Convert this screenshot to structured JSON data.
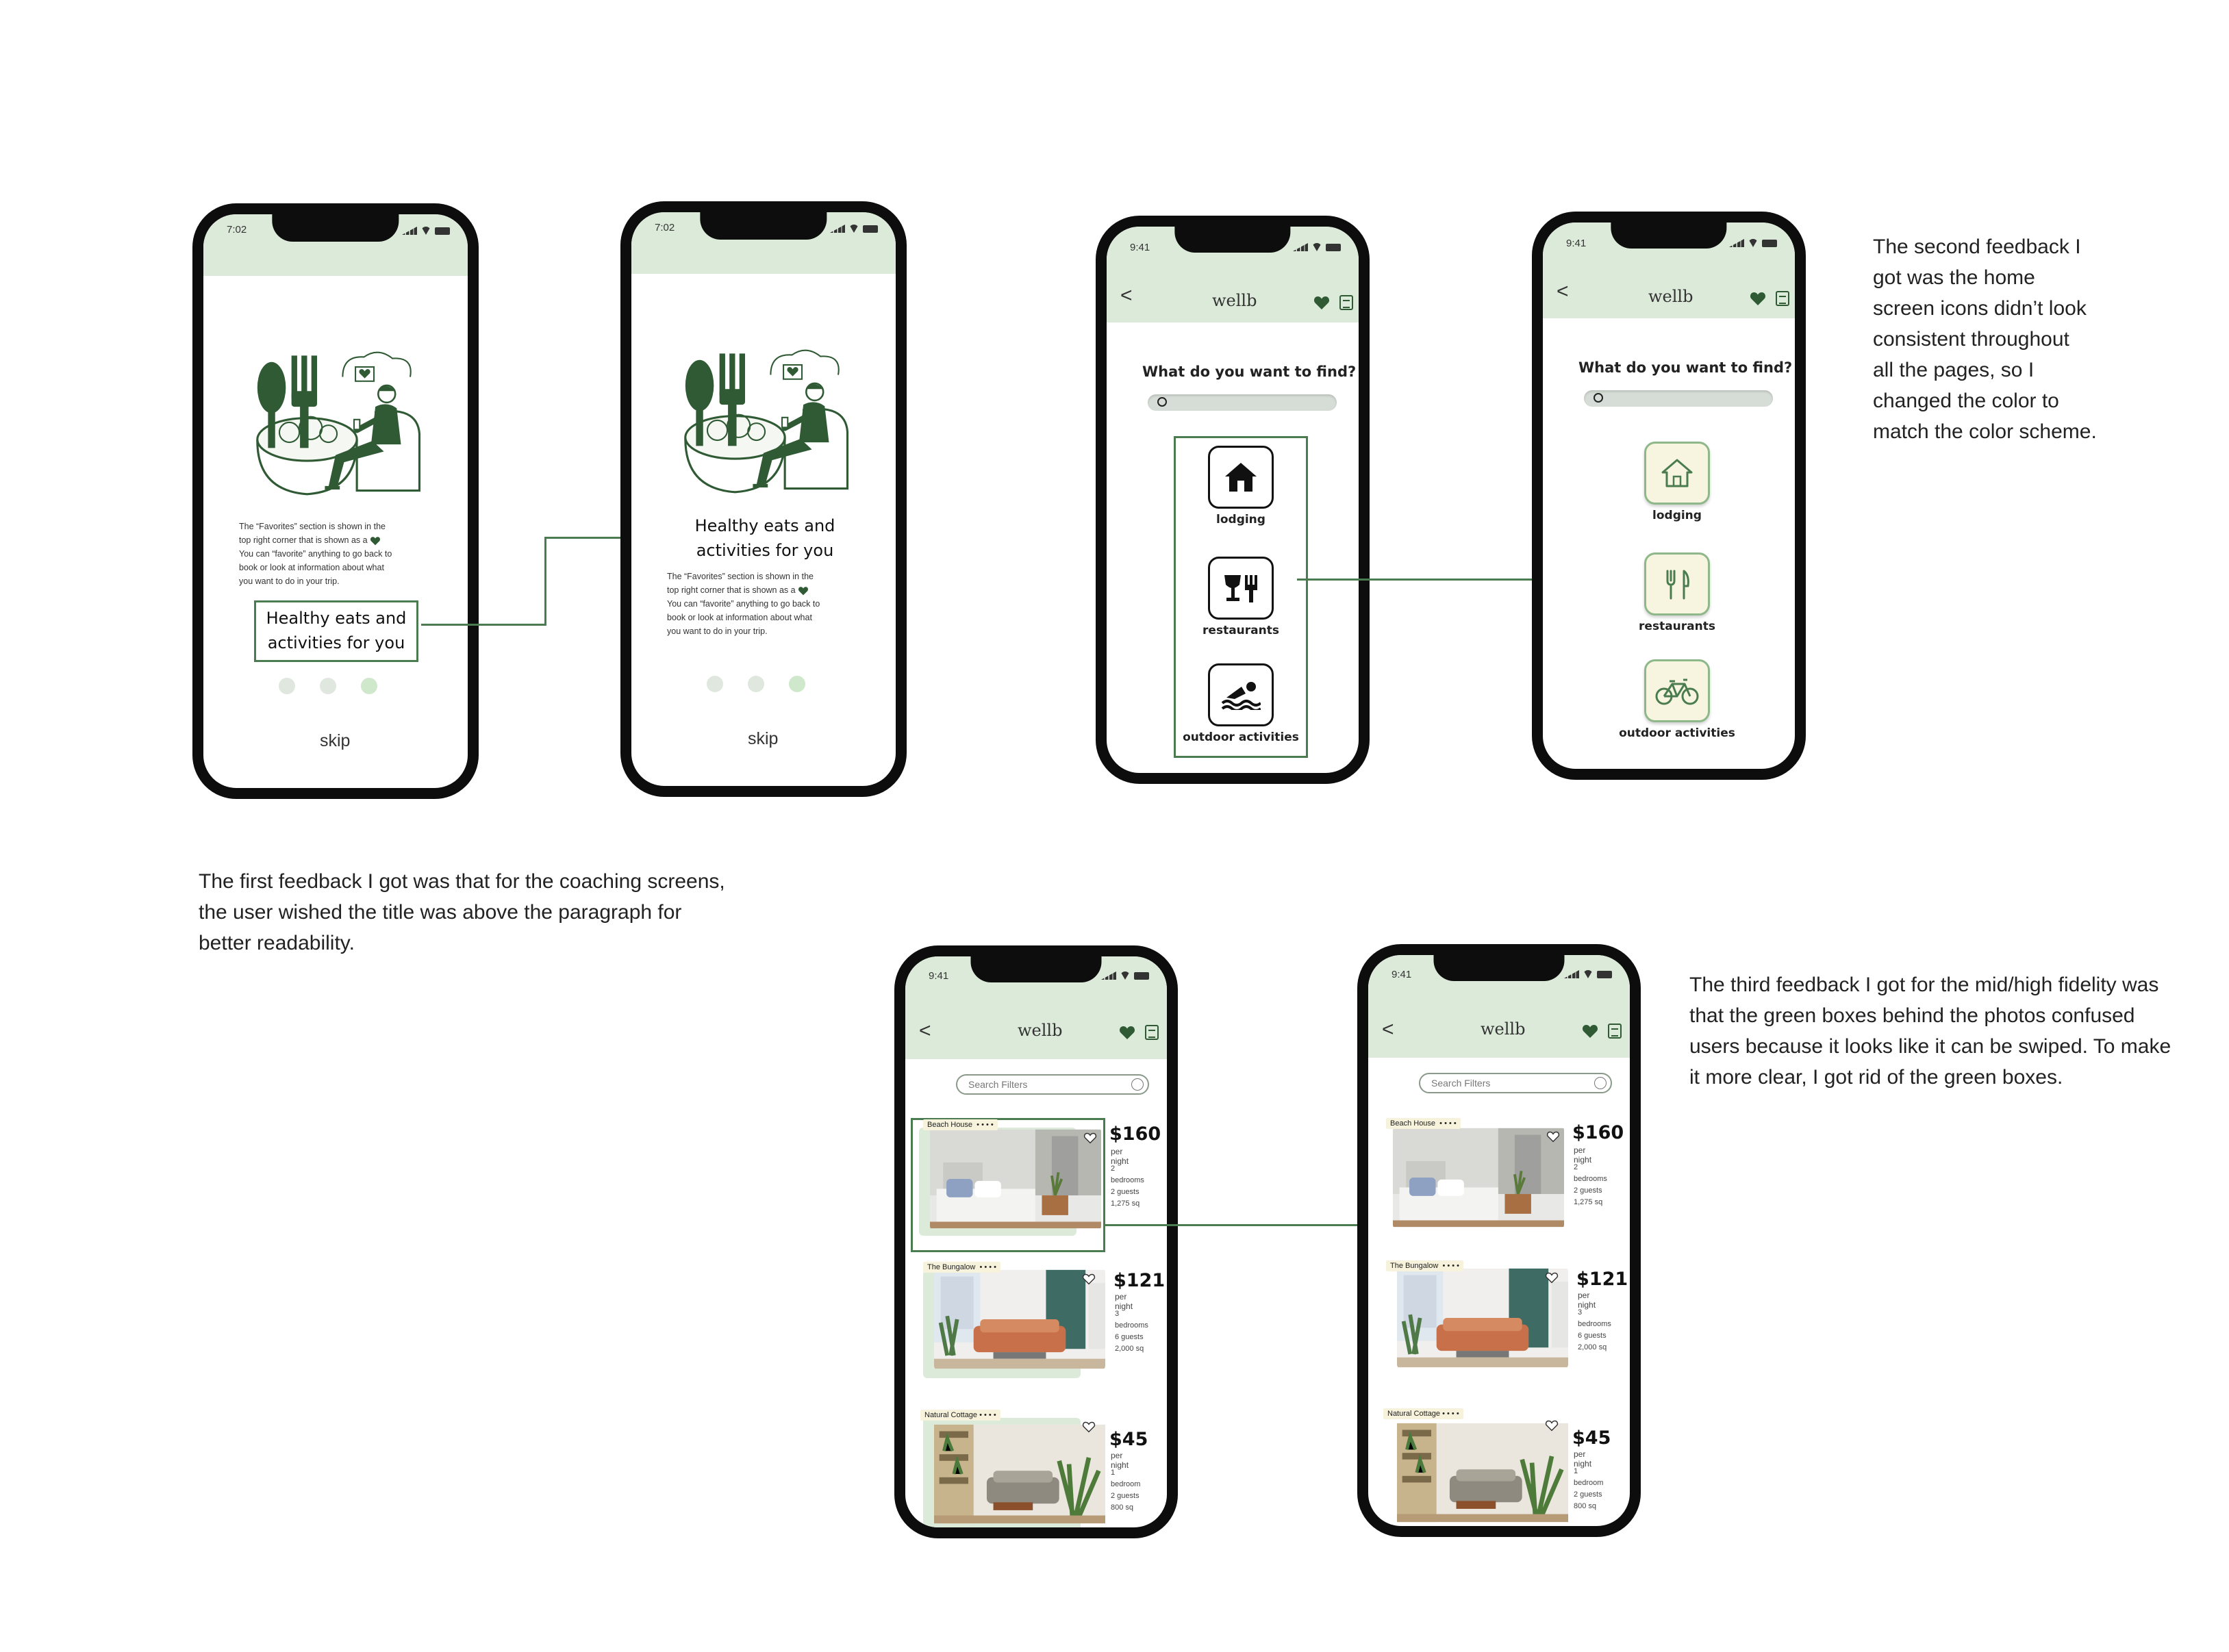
{
  "colors": {
    "accent_green": "#2f5a34",
    "band_green": "#dcebd9",
    "connector": "#4a7c4f"
  },
  "coaching_old": {
    "time": "7:02",
    "paragraph": [
      "The “Favorites” section is shown in the",
      "top right corner that is shown as a",
      "You can “favorite” anything to go back to",
      "book or look at information about what",
      "you want to do in your trip."
    ],
    "title_line1": "Healthy eats and",
    "title_line2": "activities for you",
    "skip": "skip"
  },
  "coaching_new": {
    "time": "7:02",
    "title_line1": "Healthy eats and",
    "title_line2": "activities for you",
    "paragraph": [
      "The “Favorites” section is shown in the",
      "top right corner that is shown as a",
      "You can “favorite” anything to go back to",
      "book or look at information about what",
      "you want to do in your trip."
    ],
    "skip": "skip"
  },
  "home": {
    "time": "9:41",
    "back": "<",
    "title": "wellb",
    "question": "What do you want to find?",
    "categories": [
      "lodging",
      "restaurants",
      "outdoor activities"
    ]
  },
  "listings_screen": {
    "time": "9:41",
    "back": "<",
    "title": "wellb",
    "search_placeholder": "Search Filters",
    "items": [
      {
        "name": "Beach House",
        "dots": "• • • •",
        "price": "$160",
        "per": "per night",
        "d1": "2 bedrooms",
        "d2": "2 guests",
        "d3": "1,275 sq"
      },
      {
        "name": "The Bungalow",
        "dots": "• • • •",
        "price": "$121",
        "per": "per night",
        "d1": "3 bedrooms",
        "d2": "6 guests",
        "d3": "2,000 sq"
      },
      {
        "name": "Natural Cottage",
        "dots": "• • • •",
        "price": "$45",
        "per": "per night",
        "d1": "1 bedroom",
        "d2": "2 guests",
        "d3": "800 sq"
      }
    ]
  },
  "notes": {
    "first": [
      "The first feedback I got was that for the coaching screens,",
      "the user wished the title was above the paragraph for",
      "better readability."
    ],
    "second": [
      "The second feedback I",
      "got was the home",
      "screen icons didn’t look",
      "consistent throughout",
      "all the pages, so I",
      "changed the color to",
      "match the color scheme."
    ],
    "third": [
      "The third feedback I got for the mid/high fidelity was",
      "that the green boxes behind the photos confused",
      "users because it looks like it can be swiped. To make",
      "it more clear, I got rid of the green boxes."
    ]
  }
}
